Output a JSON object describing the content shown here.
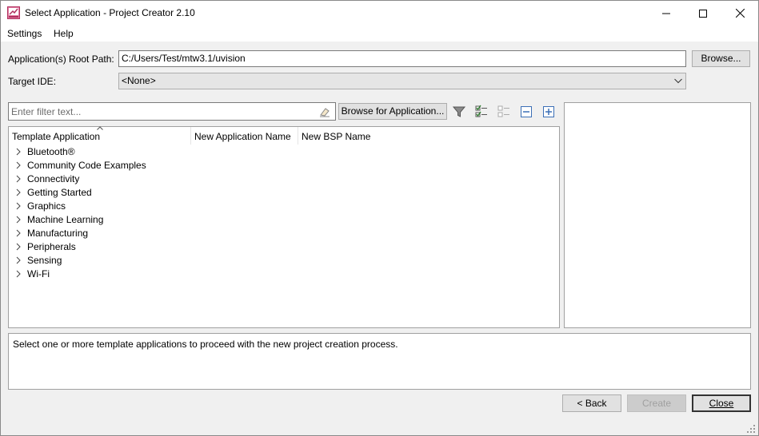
{
  "window": {
    "title": "Select Application - Project Creator 2.10"
  },
  "menu": {
    "items": [
      {
        "label": "Settings"
      },
      {
        "label": "Help"
      }
    ]
  },
  "root_path": {
    "label": "Application(s) Root Path:",
    "value": "C:/Users/Test/mtw3.1/uvision",
    "browse_label": "Browse..."
  },
  "target_ide": {
    "label": "Target IDE:",
    "value": "<None>"
  },
  "filter": {
    "placeholder": "Enter filter text...",
    "browse_app_label": "Browse for Application..."
  },
  "tree": {
    "columns": [
      "Template Application",
      "New Application Name",
      "New BSP Name"
    ],
    "items": [
      {
        "label": "Bluetooth®"
      },
      {
        "label": "Community Code Examples"
      },
      {
        "label": "Connectivity"
      },
      {
        "label": "Getting Started"
      },
      {
        "label": "Graphics"
      },
      {
        "label": "Machine Learning"
      },
      {
        "label": "Manufacturing"
      },
      {
        "label": "Peripherals"
      },
      {
        "label": "Sensing"
      },
      {
        "label": "Wi-Fi"
      }
    ]
  },
  "status": {
    "message": "Select one or more template applications to proceed with the new project creation process."
  },
  "footer": {
    "back_label": "< Back",
    "create_label": "Create",
    "close_label": "Close"
  },
  "colors": {
    "app_icon": "#c2185b",
    "disabled_text": "#a0a0a0"
  }
}
